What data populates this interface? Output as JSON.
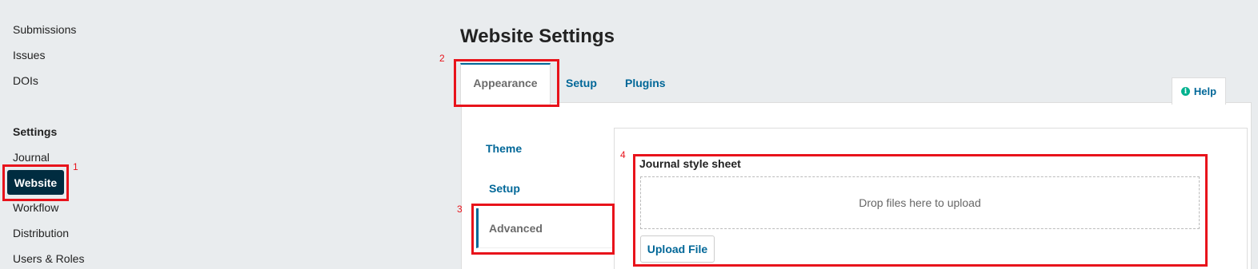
{
  "sidebar": {
    "links": [
      "Submissions",
      "Issues",
      "DOIs"
    ],
    "settings_heading": "Settings",
    "settings_items": {
      "journal": "Journal",
      "website": "Website",
      "workflow": "Workflow",
      "distribution": "Distribution",
      "users_roles": "Users & Roles"
    }
  },
  "page": {
    "title": "Website Settings"
  },
  "tabs": {
    "appearance": "Appearance",
    "setup": "Setup",
    "plugins": "Plugins",
    "help": "Help",
    "help_icon": "info-icon"
  },
  "subtabs": {
    "theme": "Theme",
    "setup": "Setup",
    "advanced": "Advanced"
  },
  "form": {
    "stylesheet_label": "Journal style sheet",
    "dropzone_text": "Drop files here to upload",
    "upload_button": "Upload File"
  },
  "annotations": {
    "n1": "1",
    "n2": "2",
    "n3": "3",
    "n4": "4",
    "color": "#e8131b"
  },
  "colors": {
    "accent": "#006798",
    "active_nav_bg": "#002c40",
    "help_icon": "#00b28f"
  }
}
